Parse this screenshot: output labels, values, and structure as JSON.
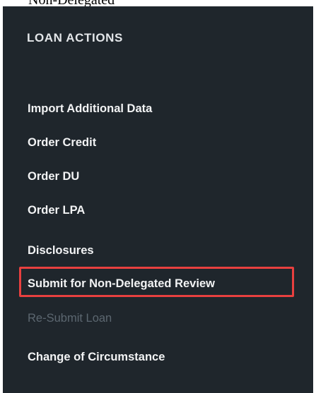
{
  "caption": {
    "text": "Non-Delegated"
  },
  "panel": {
    "title": "LOAN ACTIONS",
    "items": [
      {
        "label": "Import Additional Data",
        "enabled": true
      },
      {
        "label": "Order Credit",
        "enabled": true
      },
      {
        "label": "Order DU",
        "enabled": true
      },
      {
        "label": "Order LPA",
        "enabled": true
      },
      {
        "label": "Disclosures",
        "enabled": true
      },
      {
        "label": "Submit for Non-Delegated Review",
        "enabled": true,
        "highlighted": true
      },
      {
        "label": "Re-Submit Loan",
        "enabled": false
      },
      {
        "label": "Change of Circumstance",
        "enabled": true
      }
    ],
    "colors": {
      "background": "#1f262c",
      "text": "#f2f3f4",
      "disabled_text": "#5c6770",
      "highlight_border": "#e8403f"
    }
  }
}
